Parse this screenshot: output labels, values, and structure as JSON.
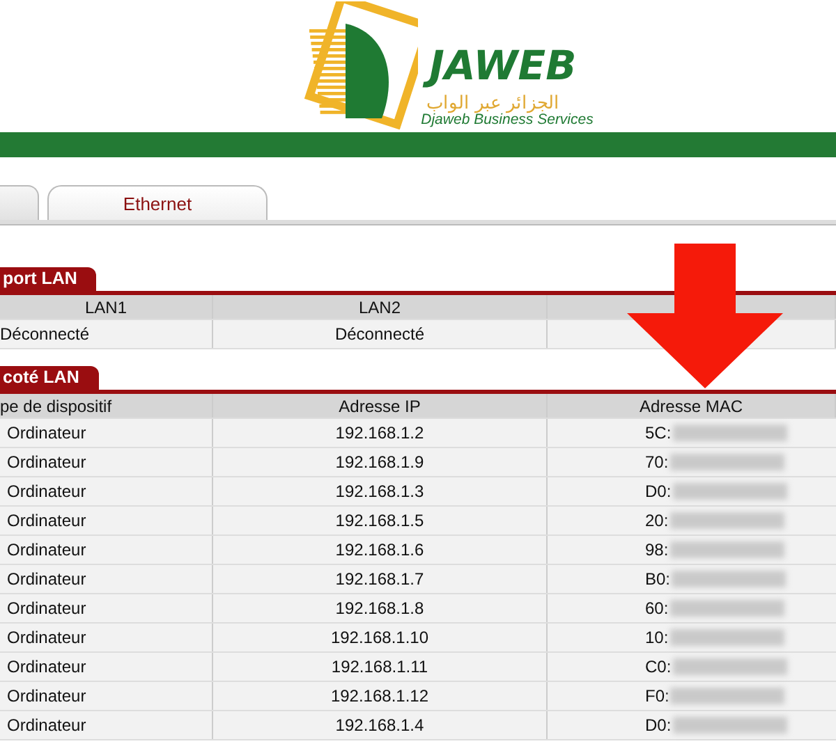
{
  "header": {
    "logo": {
      "brand": "JAWEB",
      "arabic": "الجزائر عبر الواب",
      "tagline": "Djaweb Business Services"
    }
  },
  "tabs": [
    {
      "selected": false
    },
    {
      "label": "Ethernet",
      "selected": true
    }
  ],
  "port_section": {
    "title": "port LAN",
    "columns": [
      "LAN1",
      "LAN2",
      ""
    ],
    "rows": [
      [
        "Déconnecté",
        "Déconnecté",
        ""
      ]
    ]
  },
  "lan_section": {
    "title": "coté LAN",
    "columns": [
      "pe de dispositif",
      "Adresse IP",
      "Adresse MAC"
    ],
    "rows": [
      {
        "type": "Ordinateur",
        "ip": "192.168.1.2",
        "mac": "5C:"
      },
      {
        "type": "Ordinateur",
        "ip": "192.168.1.9",
        "mac": "70:"
      },
      {
        "type": "Ordinateur",
        "ip": "192.168.1.3",
        "mac": "D0:"
      },
      {
        "type": "Ordinateur",
        "ip": "192.168.1.5",
        "mac": "20:"
      },
      {
        "type": "Ordinateur",
        "ip": "192.168.1.6",
        "mac": "98:"
      },
      {
        "type": "Ordinateur",
        "ip": "192.168.1.7",
        "mac": "B0:"
      },
      {
        "type": "Ordinateur",
        "ip": "192.168.1.8",
        "mac": "60:"
      },
      {
        "type": "Ordinateur",
        "ip": "192.168.1.10",
        "mac": "10:"
      },
      {
        "type": "Ordinateur",
        "ip": "192.168.1.11",
        "mac": "C0:"
      },
      {
        "type": "Ordinateur",
        "ip": "192.168.1.12",
        "mac": "F0:"
      },
      {
        "type": "Ordinateur",
        "ip": "192.168.1.4",
        "mac": "D0:"
      }
    ]
  }
}
